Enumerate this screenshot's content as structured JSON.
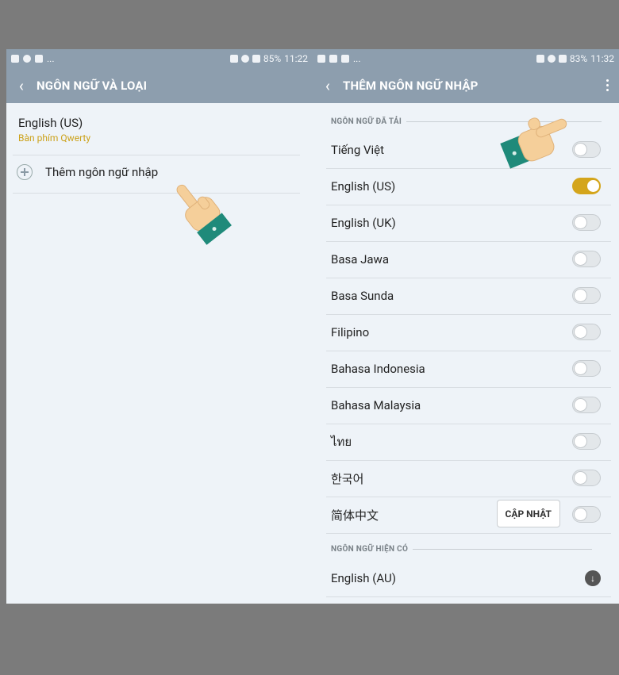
{
  "left": {
    "status": {
      "battery": "85%",
      "time": "11:22",
      "dots": "..."
    },
    "title": "NGÔN NGỮ VÀ LOẠI",
    "language": {
      "name": "English (US)",
      "sub": "Bàn phím Qwerty"
    },
    "add_label": "Thêm ngôn ngữ nhập"
  },
  "right": {
    "status": {
      "battery": "83%",
      "time": "11:32",
      "dots": "..."
    },
    "title": "THÊM NGÔN NGỮ NHẬP",
    "section_downloaded": "NGÔN NGỮ ĐÃ TẢI",
    "downloaded": [
      {
        "name": "Tiếng Việt",
        "on": false
      },
      {
        "name": "English (US)",
        "on": true
      },
      {
        "name": "English (UK)",
        "on": false
      },
      {
        "name": "Basa Jawa",
        "on": false
      },
      {
        "name": "Basa Sunda",
        "on": false
      },
      {
        "name": "Filipino",
        "on": false
      },
      {
        "name": "Bahasa Indonesia",
        "on": false
      },
      {
        "name": "Bahasa Malaysia",
        "on": false
      },
      {
        "name": "ไทย",
        "on": false
      },
      {
        "name": "한국어",
        "on": false
      },
      {
        "name": "简体中文",
        "on": false
      }
    ],
    "update_label": "CẬP NHẬT",
    "section_available": "NGÔN NGỮ HIỆN CÓ",
    "available": [
      {
        "name": "English (AU)"
      }
    ]
  },
  "colors": {
    "header": "#8d9eae",
    "accent": "#d4a51b",
    "background": "#eef3f8"
  },
  "icons": [
    "back-arrow-icon",
    "plus-icon",
    "download-icon",
    "more-vert-icon",
    "pointing-hand-icon"
  ]
}
